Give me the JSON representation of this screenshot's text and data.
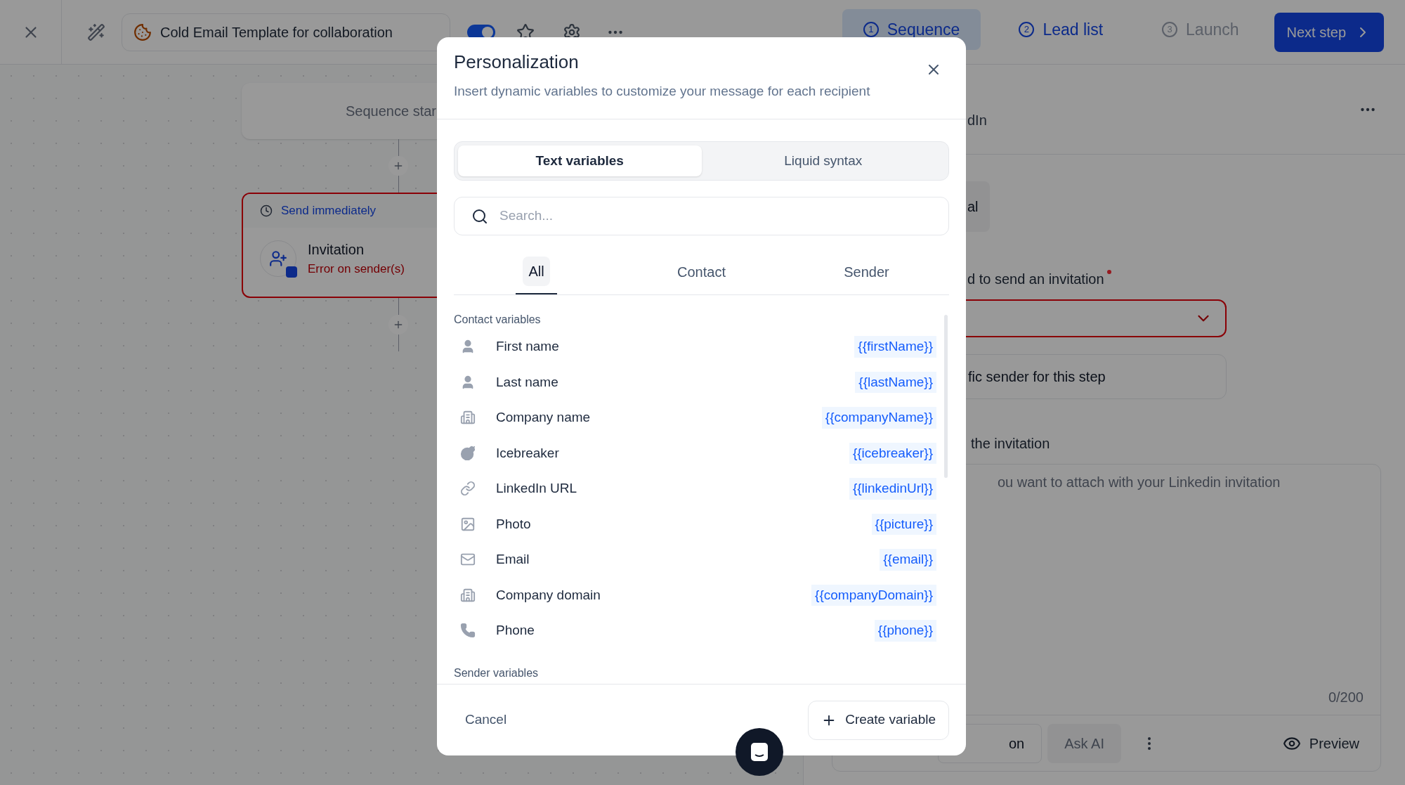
{
  "topbar": {
    "template_title": "Cold Email Template for collaboration",
    "toggle_on": true,
    "steps": [
      {
        "number": "1",
        "label": "Sequence",
        "selected": true,
        "disabled": false
      },
      {
        "number": "2",
        "label": "Lead list",
        "selected": false,
        "disabled": false
      },
      {
        "number": "3",
        "label": "Launch",
        "selected": false,
        "disabled": true
      }
    ],
    "next_button": "Next step"
  },
  "canvas": {
    "start_node": "Sequence star",
    "step_node": {
      "delay": "Send immediately",
      "title": "Invitation",
      "error": "Error on sender(s)",
      "has_error": true
    }
  },
  "step_panel": {
    "header": "dIn",
    "tab": "al",
    "sender_label": "d to send an invitation",
    "required": true,
    "sender_select_error": true,
    "sender_option": "fic sender for this step",
    "message_label": "the invitation",
    "message_placeholder": "ou want to attach with your Linkedin invitation",
    "counter": "0/200",
    "actions": [
      "on",
      "Ask AI"
    ],
    "preview": "Preview"
  },
  "modal": {
    "title": "Personalization",
    "subtitle": "Insert dynamic variables to customize your message for each recipient",
    "modes": [
      {
        "label": "Text variables",
        "selected": true
      },
      {
        "label": "Liquid syntax",
        "selected": false
      }
    ],
    "search": {
      "placeholder": "Search..."
    },
    "filters": [
      {
        "label": "All",
        "selected": true
      },
      {
        "label": "Contact",
        "selected": false
      },
      {
        "label": "Sender",
        "selected": false
      }
    ],
    "sections": [
      {
        "title": "Contact variables",
        "variables": [
          {
            "kind": "person",
            "label": "First name",
            "token": "{{firstName}}"
          },
          {
            "kind": "person",
            "label": "Last name",
            "token": "{{lastName}}"
          },
          {
            "kind": "building",
            "label": "Company name",
            "token": "{{companyName}}"
          },
          {
            "kind": "bomb",
            "label": "Icebreaker",
            "token": "{{icebreaker}}"
          },
          {
            "kind": "link",
            "label": "LinkedIn URL",
            "token": "{{linkedinUrl}}"
          },
          {
            "kind": "image",
            "label": "Photo",
            "token": "{{picture}}"
          },
          {
            "kind": "mail",
            "label": "Email",
            "token": "{{email}}"
          },
          {
            "kind": "building",
            "label": "Company domain",
            "token": "{{companyDomain}}"
          },
          {
            "kind": "phone",
            "label": "Phone",
            "token": "{{phone}}"
          }
        ]
      },
      {
        "title": "Sender variables"
      }
    ],
    "cancel": "Cancel",
    "create": "Create variable"
  }
}
